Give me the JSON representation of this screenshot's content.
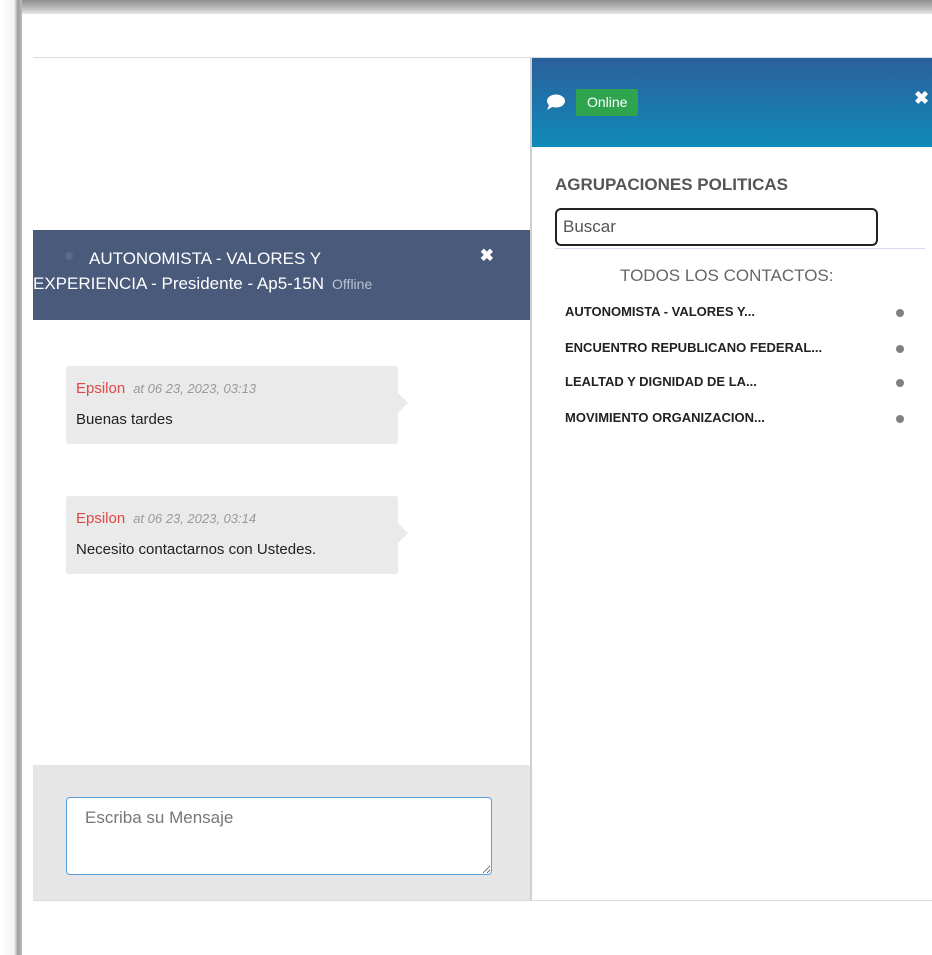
{
  "chat": {
    "title_line1": "AUTONOMISTA - VALORES Y",
    "title_line2": "EXPERIENCIA - Presidente - Ap5-15N",
    "status": "Offline",
    "close_glyph": "✖",
    "messages": [
      {
        "author": "Epsilon",
        "timestamp": "at 06 23, 2023, 03:13",
        "text": "Buenas tardes"
      },
      {
        "author": "Epsilon",
        "timestamp": "at 06 23, 2023, 03:14",
        "text": "Necesito contactarnos con Ustedes."
      }
    ],
    "composer_placeholder": "Escriba su Mensaje"
  },
  "contacts": {
    "header": {
      "icon": "chat-bubble-icon",
      "status_badge": "Online",
      "close_glyph": "✖"
    },
    "section_title": "AGRUPACIONES POLITICAS",
    "search_placeholder": "Buscar",
    "all_contacts_label": "TODOS LOS CONTACTOS:",
    "items": [
      {
        "name": "AUTONOMISTA - VALORES Y..."
      },
      {
        "name": "ENCUENTRO REPUBLICANO FEDERAL..."
      },
      {
        "name": "LEALTAD Y DIGNIDAD DE LA..."
      },
      {
        "name": "MOVIMIENTO ORGANIZACION..."
      }
    ]
  },
  "colors": {
    "chat_header_bg": "#4a5a7a",
    "contacts_header_top": "#2b5f9c",
    "contacts_header_bottom": "#0f8ab8",
    "online_green": "#2ea44f",
    "author_red": "#e04848",
    "status_dot_gray": "#808080"
  }
}
